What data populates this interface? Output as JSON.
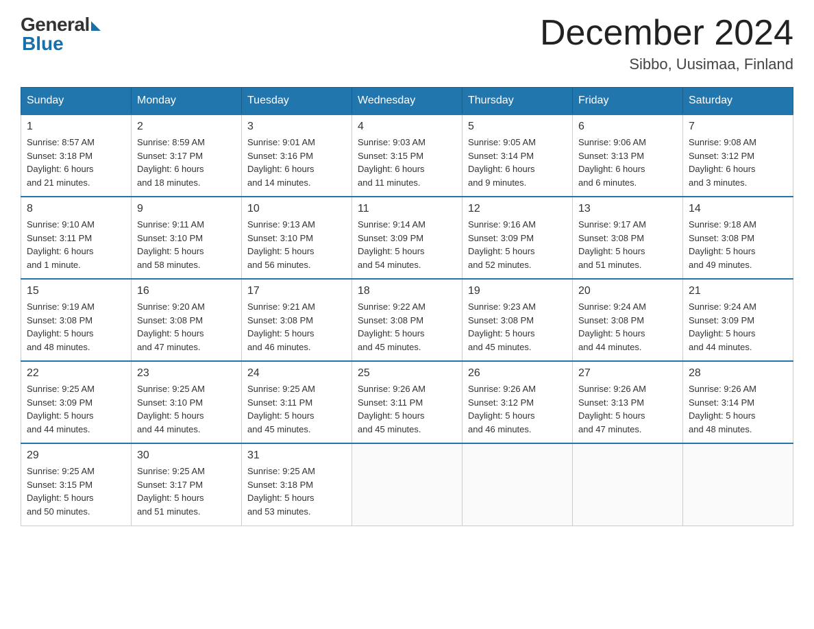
{
  "logo": {
    "general": "General",
    "blue": "Blue"
  },
  "header": {
    "month": "December 2024",
    "location": "Sibbo, Uusimaa, Finland"
  },
  "days_of_week": [
    "Sunday",
    "Monday",
    "Tuesday",
    "Wednesday",
    "Thursday",
    "Friday",
    "Saturday"
  ],
  "weeks": [
    [
      {
        "day": "1",
        "sunrise": "8:57 AM",
        "sunset": "3:18 PM",
        "daylight": "6 hours and 21 minutes."
      },
      {
        "day": "2",
        "sunrise": "8:59 AM",
        "sunset": "3:17 PM",
        "daylight": "6 hours and 18 minutes."
      },
      {
        "day": "3",
        "sunrise": "9:01 AM",
        "sunset": "3:16 PM",
        "daylight": "6 hours and 14 minutes."
      },
      {
        "day": "4",
        "sunrise": "9:03 AM",
        "sunset": "3:15 PM",
        "daylight": "6 hours and 11 minutes."
      },
      {
        "day": "5",
        "sunrise": "9:05 AM",
        "sunset": "3:14 PM",
        "daylight": "6 hours and 9 minutes."
      },
      {
        "day": "6",
        "sunrise": "9:06 AM",
        "sunset": "3:13 PM",
        "daylight": "6 hours and 6 minutes."
      },
      {
        "day": "7",
        "sunrise": "9:08 AM",
        "sunset": "3:12 PM",
        "daylight": "6 hours and 3 minutes."
      }
    ],
    [
      {
        "day": "8",
        "sunrise": "9:10 AM",
        "sunset": "3:11 PM",
        "daylight": "6 hours and 1 minute."
      },
      {
        "day": "9",
        "sunrise": "9:11 AM",
        "sunset": "3:10 PM",
        "daylight": "5 hours and 58 minutes."
      },
      {
        "day": "10",
        "sunrise": "9:13 AM",
        "sunset": "3:10 PM",
        "daylight": "5 hours and 56 minutes."
      },
      {
        "day": "11",
        "sunrise": "9:14 AM",
        "sunset": "3:09 PM",
        "daylight": "5 hours and 54 minutes."
      },
      {
        "day": "12",
        "sunrise": "9:16 AM",
        "sunset": "3:09 PM",
        "daylight": "5 hours and 52 minutes."
      },
      {
        "day": "13",
        "sunrise": "9:17 AM",
        "sunset": "3:08 PM",
        "daylight": "5 hours and 51 minutes."
      },
      {
        "day": "14",
        "sunrise": "9:18 AM",
        "sunset": "3:08 PM",
        "daylight": "5 hours and 49 minutes."
      }
    ],
    [
      {
        "day": "15",
        "sunrise": "9:19 AM",
        "sunset": "3:08 PM",
        "daylight": "5 hours and 48 minutes."
      },
      {
        "day": "16",
        "sunrise": "9:20 AM",
        "sunset": "3:08 PM",
        "daylight": "5 hours and 47 minutes."
      },
      {
        "day": "17",
        "sunrise": "9:21 AM",
        "sunset": "3:08 PM",
        "daylight": "5 hours and 46 minutes."
      },
      {
        "day": "18",
        "sunrise": "9:22 AM",
        "sunset": "3:08 PM",
        "daylight": "5 hours and 45 minutes."
      },
      {
        "day": "19",
        "sunrise": "9:23 AM",
        "sunset": "3:08 PM",
        "daylight": "5 hours and 45 minutes."
      },
      {
        "day": "20",
        "sunrise": "9:24 AM",
        "sunset": "3:08 PM",
        "daylight": "5 hours and 44 minutes."
      },
      {
        "day": "21",
        "sunrise": "9:24 AM",
        "sunset": "3:09 PM",
        "daylight": "5 hours and 44 minutes."
      }
    ],
    [
      {
        "day": "22",
        "sunrise": "9:25 AM",
        "sunset": "3:09 PM",
        "daylight": "5 hours and 44 minutes."
      },
      {
        "day": "23",
        "sunrise": "9:25 AM",
        "sunset": "3:10 PM",
        "daylight": "5 hours and 44 minutes."
      },
      {
        "day": "24",
        "sunrise": "9:25 AM",
        "sunset": "3:11 PM",
        "daylight": "5 hours and 45 minutes."
      },
      {
        "day": "25",
        "sunrise": "9:26 AM",
        "sunset": "3:11 PM",
        "daylight": "5 hours and 45 minutes."
      },
      {
        "day": "26",
        "sunrise": "9:26 AM",
        "sunset": "3:12 PM",
        "daylight": "5 hours and 46 minutes."
      },
      {
        "day": "27",
        "sunrise": "9:26 AM",
        "sunset": "3:13 PM",
        "daylight": "5 hours and 47 minutes."
      },
      {
        "day": "28",
        "sunrise": "9:26 AM",
        "sunset": "3:14 PM",
        "daylight": "5 hours and 48 minutes."
      }
    ],
    [
      {
        "day": "29",
        "sunrise": "9:25 AM",
        "sunset": "3:15 PM",
        "daylight": "5 hours and 50 minutes."
      },
      {
        "day": "30",
        "sunrise": "9:25 AM",
        "sunset": "3:17 PM",
        "daylight": "5 hours and 51 minutes."
      },
      {
        "day": "31",
        "sunrise": "9:25 AM",
        "sunset": "3:18 PM",
        "daylight": "5 hours and 53 minutes."
      },
      null,
      null,
      null,
      null
    ]
  ],
  "labels": {
    "sunrise": "Sunrise:",
    "sunset": "Sunset:",
    "daylight": "Daylight:"
  }
}
